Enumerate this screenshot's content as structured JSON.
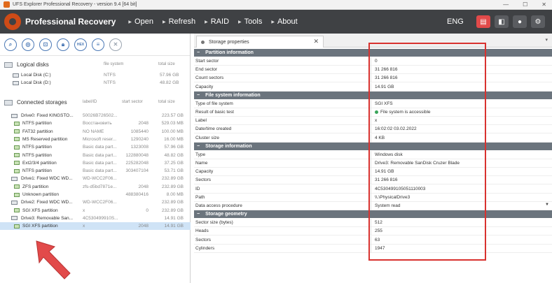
{
  "window": {
    "title": "UFS Explorer Professional Recovery - version 9.4 [64 bit]",
    "controls": [
      "—",
      "☐",
      "✕"
    ]
  },
  "menubar": {
    "brand": "Professional Recovery",
    "items": [
      "Open",
      "Refresh",
      "RAID",
      "Tools",
      "About"
    ],
    "lang": "ENG"
  },
  "left": {
    "logical_header": "Logical disks",
    "logical_cols": {
      "fs": "file system",
      "size": "total size"
    },
    "logical_disks": [
      {
        "name": "Local Disk (C:)",
        "fs": "NTFS",
        "size": "57.96 GB"
      },
      {
        "name": "Local Disk (D:)",
        "fs": "NTFS",
        "size": "48.82 GB"
      }
    ],
    "storages_header": "Connected storages",
    "storage_cols": {
      "label": "label/ID",
      "start": "start sector",
      "size": "total size"
    },
    "storages": [
      {
        "name": "Drive0: Fixed KINGSTO...",
        "label": "50026B726502...",
        "start": "",
        "size": "223.57 GB",
        "kind": "drive"
      },
      {
        "name": "NTFS partition",
        "label": "Восстановить",
        "start": "2048",
        "size": "529.03 MB",
        "kind": "part"
      },
      {
        "name": "FAT32 partition",
        "label": "NO NAME",
        "start": "1085440",
        "size": "100.00 MB",
        "kind": "part"
      },
      {
        "name": "MS Reserved partition",
        "label": "Microsoft reser...",
        "start": "1290240",
        "size": "16.00 MB",
        "kind": "part"
      },
      {
        "name": "NTFS partition",
        "label": "Basic data part...",
        "start": "1323008",
        "size": "57.96 GB",
        "kind": "part"
      },
      {
        "name": "NTFS partition",
        "label": "Basic data part...",
        "start": "122880048",
        "size": "48.82 GB",
        "kind": "part"
      },
      {
        "name": "Ext2/3/4 partition",
        "label": "Basic data part...",
        "start": "225282048",
        "size": "37.25 GB",
        "kind": "part"
      },
      {
        "name": "NTFS partition",
        "label": "Basic data part...",
        "start": "303407104",
        "size": "53.71 GB",
        "kind": "part"
      },
      {
        "name": "Drive1: Fixed WDC WD...",
        "label": "WD-WCC2F06...",
        "start": "",
        "size": "232.89 GB",
        "kind": "drive"
      },
      {
        "name": "ZFS partition",
        "label": "zfs-d5bd7871e...",
        "start": "2048",
        "size": "232.89 GB",
        "kind": "part"
      },
      {
        "name": "Unknown partition",
        "label": "",
        "start": "488380416",
        "size": "8.00 MB",
        "kind": "part"
      },
      {
        "name": "Drive2: Fixed WDC WD...",
        "label": "WD-WCC2F06...",
        "start": "",
        "size": "232.89 GB",
        "kind": "drive"
      },
      {
        "name": "SGI XFS partition",
        "label": "x",
        "start": "0",
        "size": "232.89 GB",
        "kind": "part"
      },
      {
        "name": "Drive3: Removable San...",
        "label": "4C530499910S...",
        "start": "",
        "size": "14.91 GB",
        "kind": "drive"
      },
      {
        "name": "SGI XFS partition",
        "label": "x",
        "start": "2048",
        "size": "14.91 GB",
        "kind": "part",
        "selected": true
      }
    ]
  },
  "tab": {
    "label": "Storage properties"
  },
  "groups": [
    {
      "title": "Partition information",
      "props": [
        {
          "name": "Start sector",
          "value": "0"
        },
        {
          "name": "End sector",
          "value": "31 266 816"
        },
        {
          "name": "Count sectors",
          "value": "31 266 816"
        },
        {
          "name": "Capacity",
          "value": "14.91 GB"
        }
      ]
    },
    {
      "title": "File system information",
      "props": [
        {
          "name": "Type of file system",
          "value": "SGI XFS"
        },
        {
          "name": "Result of basic test",
          "value": "File system is accessible",
          "ok": true
        },
        {
          "name": "Label",
          "value": "x"
        },
        {
          "name": "Date/time created",
          "value": "16:02:02 03.02.2022"
        },
        {
          "name": "Cluster size",
          "value": "4 KB"
        }
      ]
    },
    {
      "title": "Storage information",
      "props": [
        {
          "name": "Type",
          "value": "Windows disk"
        },
        {
          "name": "Name",
          "value": "Drive3: Removable SanDisk Cruzer Blade"
        },
        {
          "name": "Capacity",
          "value": "14.91 GB"
        },
        {
          "name": "Sectors",
          "value": "31 266 816"
        },
        {
          "name": "ID",
          "value": "4C530499105051110003"
        },
        {
          "name": "Path",
          "value": "\\\\.\\PhysicalDrive3"
        },
        {
          "name": "Data access procedure",
          "value": "System read",
          "dropdown": true
        }
      ]
    },
    {
      "title": "Storage geometry",
      "props": [
        {
          "name": "Sector size (bytes)",
          "value": "512"
        },
        {
          "name": "Heads",
          "value": "255"
        },
        {
          "name": "Sectors",
          "value": "63"
        },
        {
          "name": "Cylinders",
          "value": "1947"
        }
      ]
    }
  ],
  "colors": {
    "accent": "#cf4b17",
    "annotation": "#d8322f",
    "menubar": "#3f4144",
    "group_header": "#6b747d"
  },
  "toolbar_icons": [
    "search-icon",
    "scan-icon",
    "car-icon",
    "lock-icon",
    "hex-icon",
    "list-icon",
    "close-icon"
  ]
}
